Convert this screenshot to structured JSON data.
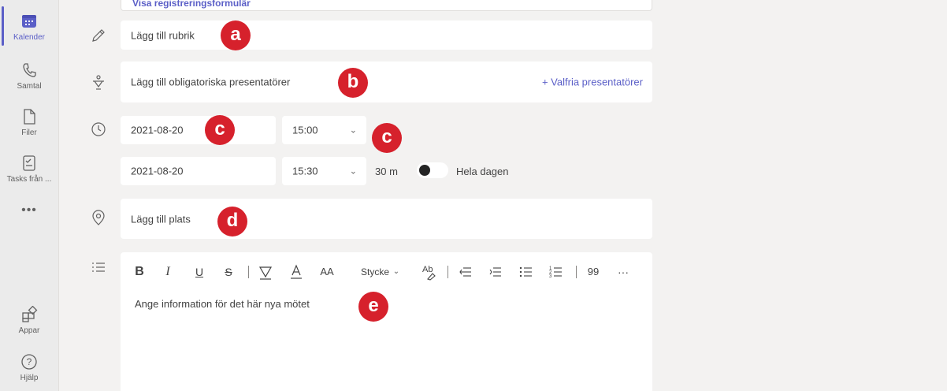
{
  "rail": {
    "items": [
      {
        "label": "Kalender",
        "icon": "calendar-icon"
      },
      {
        "label": "Samtal",
        "icon": "phone-icon"
      },
      {
        "label": "Filer",
        "icon": "file-icon"
      },
      {
        "label": "Tasks från ...",
        "icon": "tasks-icon"
      }
    ],
    "more": "•••",
    "apps": "Appar",
    "help": "Hjälp"
  },
  "form": {
    "top_link": "Visa registreringsformulär",
    "title_placeholder": "Lägg till rubrik",
    "presenters_placeholder": "Lägg till obligatoriska presentatörer",
    "optional_presenters": "+ Valfria presentatörer",
    "start_date": "2021-08-20",
    "start_time": "15:00",
    "end_date": "2021-08-20",
    "end_time": "15:30",
    "duration": "30 m",
    "all_day": "Hela dagen",
    "all_day_on": false,
    "location_placeholder": "Lägg till plats",
    "details_placeholder": "Ange information för det här nya mötet"
  },
  "toolbar": {
    "bold": "B",
    "italic": "I",
    "underline": "U",
    "strike": "S",
    "font_size": "AA",
    "paragraph": "Stycke",
    "quote": "99",
    "more": "···"
  },
  "badges": {
    "a": "a",
    "b": "b",
    "c1": "c",
    "c2": "c",
    "d": "d",
    "e": "e"
  },
  "colors": {
    "accent": "#5b5fc7",
    "badge": "#d6212c"
  }
}
